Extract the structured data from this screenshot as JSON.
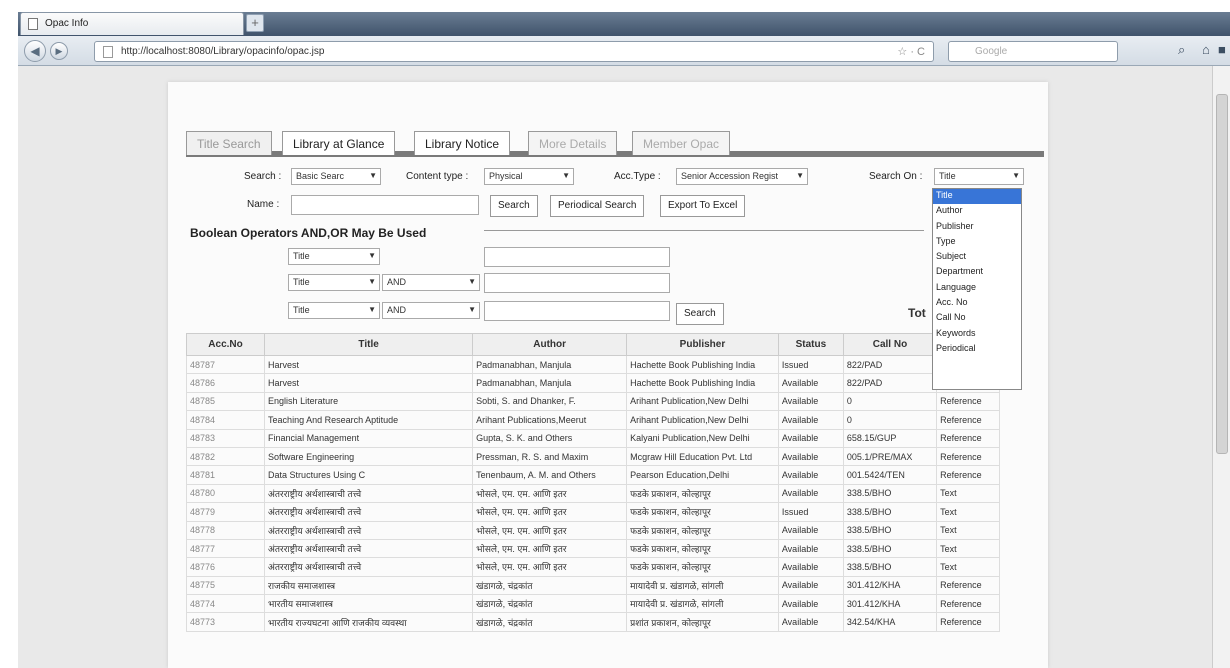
{
  "browser": {
    "tab_title": "Opac Info",
    "url": "http://localhost:8080/Library/opacinfo/opac.jsp",
    "search_placeholder": "Google"
  },
  "tabs": [
    "Title Search",
    "Library at Glance",
    "Library Notice",
    "More Details",
    "Member Opac"
  ],
  "form": {
    "search_label": "Search :",
    "search_value": "Basic Searc",
    "content_label": "Content type :",
    "content_value": "Physical",
    "acctype_label": "Acc.Type :",
    "acctype_value": "Senior Accession Regist",
    "searchon_label": "Search On :",
    "searchon_value": "Title",
    "name_label": "Name :",
    "search_btn": "Search",
    "periodical_btn": "Periodical Search",
    "excel_btn": "Export To Excel"
  },
  "boolean": {
    "heading": "Boolean Operators AND,OR May Be Used",
    "field1": "Title",
    "field2": "Title",
    "op2": "AND",
    "field3": "Title",
    "op3": "AND",
    "search_btn": "Search"
  },
  "dropdown_options": [
    "Title",
    "Author",
    "Publisher",
    "Type",
    "Subject",
    "Department",
    "Language",
    "Acc. No",
    "Call No",
    "Keywords",
    "Periodical"
  ],
  "total_label": "Tot",
  "table": {
    "headers": [
      "Acc.No",
      "Title",
      "Author",
      "Publisher",
      "Status",
      "Call No",
      "Su"
    ],
    "rows": [
      [
        "48787",
        "Harvest",
        "Padmanabhan, Manjula",
        "Hachette Book Publishing India",
        "Issued",
        "822/PAD",
        "Reference"
      ],
      [
        "48786",
        "Harvest",
        "Padmanabhan, Manjula",
        "Hachette Book Publishing India",
        "Available",
        "822/PAD",
        "Reference"
      ],
      [
        "48785",
        "English Literature",
        "Sobti, S. and Dhanker, F.",
        "Arihant Publication,New Delhi",
        "Available",
        "0",
        "Reference"
      ],
      [
        "48784",
        "Teaching And Research Aptitude",
        "Arihant Publications,Meerut",
        "Arihant Publication,New Delhi",
        "Available",
        "0",
        "Reference"
      ],
      [
        "48783",
        "Financial Management",
        "Gupta, S. K. and Others",
        "Kalyani Publication,New Delhi",
        "Available",
        "658.15/GUP",
        "Reference"
      ],
      [
        "48782",
        "Software Engineering",
        "Pressman, R. S. and Maxim",
        "Mcgraw Hill Education Pvt. Ltd",
        "Available",
        "005.1/PRE/MAX",
        "Reference"
      ],
      [
        "48781",
        "Data Structures Using C",
        "Tenenbaum, A. M. and Others",
        "Pearson Education,Delhi",
        "Available",
        "001.5424/TEN",
        "Reference"
      ],
      [
        "48780",
        "अंतरराष्ट्रीय अर्थशास्त्राची तत्त्वे",
        "भोसले, एम. एम. आणि इतर",
        "फडके प्रकाशन, कोल्हापूर",
        "Available",
        "338.5/BHO",
        "Text"
      ],
      [
        "48779",
        "अंतरराष्ट्रीय अर्थशास्त्राची तत्त्वे",
        "भोसले, एम. एम. आणि इतर",
        "फडके प्रकाशन, कोल्हापूर",
        "Issued",
        "338.5/BHO",
        "Text"
      ],
      [
        "48778",
        "अंतरराष्ट्रीय अर्थशास्त्राची तत्त्वे",
        "भोसले, एम. एम. आणि इतर",
        "फडके प्रकाशन, कोल्हापूर",
        "Available",
        "338.5/BHO",
        "Text"
      ],
      [
        "48777",
        "अंतरराष्ट्रीय अर्थशास्त्राची तत्त्वे",
        "भोसले, एम. एम. आणि इतर",
        "फडके प्रकाशन, कोल्हापूर",
        "Available",
        "338.5/BHO",
        "Text"
      ],
      [
        "48776",
        "अंतरराष्ट्रीय अर्थशास्त्राची तत्त्वे",
        "भोसले, एम. एम. आणि इतर",
        "फडके प्रकाशन, कोल्हापूर",
        "Available",
        "338.5/BHO",
        "Text"
      ],
      [
        "48775",
        "राजकीय समाजशास्त्र",
        "खंडागळे, चंद्रकांत",
        "मायादेवी प्र. खंडागळे, सांगली",
        "Available",
        "301.412/KHA",
        "Reference"
      ],
      [
        "48774",
        "भारतीय समाजशास्त्र",
        "खंडागळे, चंद्रकांत",
        "मायादेवी प्र. खंडागळे, सांगली",
        "Available",
        "301.412/KHA",
        "Reference"
      ],
      [
        "48773",
        "भारतीय राज्यघटना आणि राजकीय व्यवस्था",
        "खंडागळे, चंद्रकांत",
        "प्रशांत प्रकाशन, कोल्हापूर",
        "Available",
        "342.54/KHA",
        "Reference"
      ]
    ]
  }
}
